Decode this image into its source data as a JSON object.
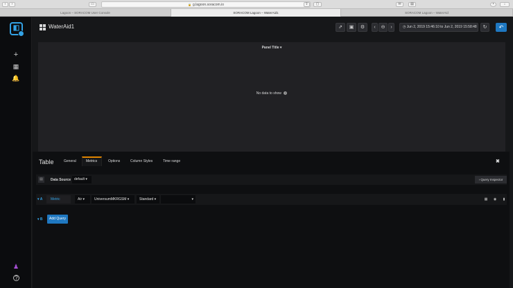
{
  "browser": {
    "url": "g.lagoon.soracom.io",
    "tabs": [
      {
        "label": "Lagoon – SORACOM User Console"
      },
      {
        "label": "SORACOM Lagoon – WaterAid1"
      },
      {
        "label": "SORACOM Lagoon – WaterAid"
      }
    ]
  },
  "navbar": {
    "title": "WaterAid1",
    "time_range": "Jun 2, 2019 15:46:10 to Jun 2, 2019 15:58:48"
  },
  "panel": {
    "title": "Panel Title",
    "title_caret": "▾",
    "empty_message": "No data to show",
    "info_glyph": "?"
  },
  "editor": {
    "title": "Table",
    "tabs": [
      "General",
      "Metrics",
      "Options",
      "Column Styles",
      "Time range"
    ],
    "active_tab": "Metrics",
    "close_glyph": "✖",
    "data_source_label": "Data Source",
    "data_source_value": "default",
    "query_inspector_label": "Query Inspector",
    "queries": [
      {
        "letter": "A",
        "metric_label": "Metric",
        "selects": [
          "Air",
          "UniversumMKRGSM",
          "Standard",
          ""
        ]
      }
    ],
    "query_b_letter": "B",
    "add_query_label": "Add Query"
  },
  "colors": {
    "accent_blue": "#1f78c1",
    "link_blue": "#33a2e5",
    "active_tab_orange": "#e08400",
    "background": "#161719"
  },
  "icons": {
    "sidebar": [
      "plus-icon",
      "dashboards-icon",
      "bell-icon",
      "user-icon",
      "help-icon"
    ],
    "navbar": [
      "share-icon",
      "save-icon",
      "settings-icon",
      "chevron-left-icon",
      "zoom-out-icon",
      "chevron-right-icon",
      "clock-icon",
      "refresh-icon",
      "back-icon"
    ]
  }
}
